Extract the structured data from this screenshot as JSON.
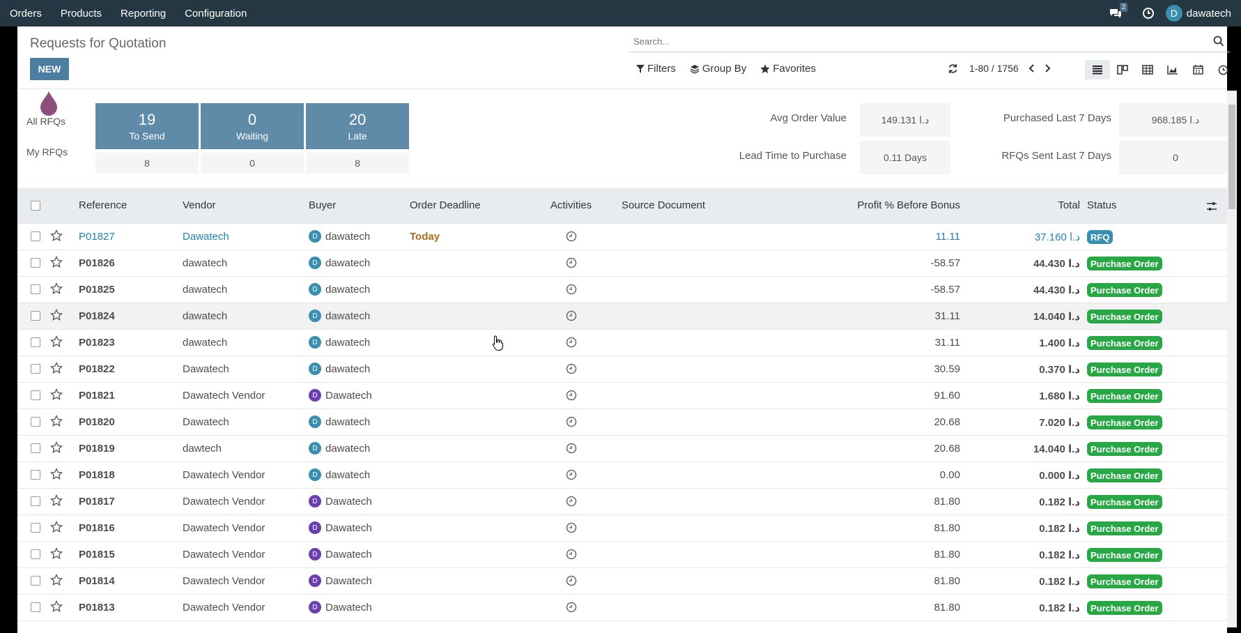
{
  "nav": {
    "menu": [
      "Orders",
      "Products",
      "Reporting",
      "Configuration"
    ],
    "messages_count": "2",
    "user": "dawatech",
    "user_initial": "D"
  },
  "control_panel": {
    "title": "Requests for Quotation",
    "new_label": "NEW",
    "search_placeholder": "Search...",
    "filters_label": "Filters",
    "groupby_label": "Group By",
    "favorites_label": "Favorites",
    "pager": "1-80 / 1756"
  },
  "dashboard": {
    "all_rfqs": "All RFQs",
    "my_rfqs": "My RFQs",
    "tiles": [
      {
        "count": "19",
        "label": "To Send",
        "mine": "8"
      },
      {
        "count": "0",
        "label": "Waiting",
        "mine": "0"
      },
      {
        "count": "20",
        "label": "Late",
        "mine": "8"
      }
    ],
    "kpis": {
      "avg_order_label": "Avg Order Value",
      "avg_order_value": "149.131 د.ا",
      "lead_time_label": "Lead Time to Purchase",
      "lead_time_value": "0.11 Days",
      "purchased_label": "Purchased Last 7 Days",
      "purchased_value": "968.185 د.ا",
      "rfqs_sent_label": "RFQs Sent Last 7 Days",
      "rfqs_sent_value": "0"
    }
  },
  "table": {
    "headers": {
      "reference": "Reference",
      "vendor": "Vendor",
      "buyer": "Buyer",
      "deadline": "Order Deadline",
      "activities": "Activities",
      "source": "Source Document",
      "profit": "Profit % Before Bonus",
      "total": "Total",
      "status": "Status"
    },
    "rows": [
      {
        "ref": "P01827",
        "vendor": "Dawatech",
        "buyer": "dawatech",
        "buyer_color": "#3a8fb0",
        "deadline": "Today",
        "profit": "11.11",
        "total": "37.160 د.ا",
        "status": "RFQ"
      },
      {
        "ref": "P01826",
        "vendor": "dawatech",
        "buyer": "dawatech",
        "buyer_color": "#3a8fb0",
        "deadline": "",
        "profit": "-58.57",
        "total": "44.430 د.ا",
        "status": "Purchase Order"
      },
      {
        "ref": "P01825",
        "vendor": "dawatech",
        "buyer": "dawatech",
        "buyer_color": "#3a8fb0",
        "deadline": "",
        "profit": "-58.57",
        "total": "44.430 د.ا",
        "status": "Purchase Order"
      },
      {
        "ref": "P01824",
        "vendor": "dawatech",
        "buyer": "dawatech",
        "buyer_color": "#3a8fb0",
        "deadline": "",
        "profit": "31.11",
        "total": "14.040 د.ا",
        "status": "Purchase Order"
      },
      {
        "ref": "P01823",
        "vendor": "dawatech",
        "buyer": "dawatech",
        "buyer_color": "#3a8fb0",
        "deadline": "",
        "profit": "31.11",
        "total": "1.400 د.ا",
        "status": "Purchase Order"
      },
      {
        "ref": "P01822",
        "vendor": "Dawatech",
        "buyer": "dawatech",
        "buyer_color": "#3a8fb0",
        "deadline": "",
        "profit": "30.59",
        "total": "0.370 د.ا",
        "status": "Purchase Order"
      },
      {
        "ref": "P01821",
        "vendor": "Dawatech Vendor",
        "buyer": "Dawatech",
        "buyer_color": "#6b3fb0",
        "deadline": "",
        "profit": "91.60",
        "total": "1.680 د.ا",
        "status": "Purchase Order"
      },
      {
        "ref": "P01820",
        "vendor": "Dawatech",
        "buyer": "dawatech",
        "buyer_color": "#3a8fb0",
        "deadline": "",
        "profit": "20.68",
        "total": "7.020 د.ا",
        "status": "Purchase Order"
      },
      {
        "ref": "P01819",
        "vendor": "dawtech",
        "buyer": "dawatech",
        "buyer_color": "#3a8fb0",
        "deadline": "",
        "profit": "20.68",
        "total": "14.040 د.ا",
        "status": "Purchase Order"
      },
      {
        "ref": "P01818",
        "vendor": "Dawatech Vendor",
        "buyer": "dawatech",
        "buyer_color": "#3a8fb0",
        "deadline": "",
        "profit": "0.00",
        "total": "0.000 د.ا",
        "status": "Purchase Order"
      },
      {
        "ref": "P01817",
        "vendor": "Dawatech Vendor",
        "buyer": "Dawatech",
        "buyer_color": "#6b3fb0",
        "deadline": "",
        "profit": "81.80",
        "total": "0.182 د.ا",
        "status": "Purchase Order"
      },
      {
        "ref": "P01816",
        "vendor": "Dawatech Vendor",
        "buyer": "Dawatech",
        "buyer_color": "#6b3fb0",
        "deadline": "",
        "profit": "81.80",
        "total": "0.182 د.ا",
        "status": "Purchase Order"
      },
      {
        "ref": "P01815",
        "vendor": "Dawatech Vendor",
        "buyer": "Dawatech",
        "buyer_color": "#6b3fb0",
        "deadline": "",
        "profit": "81.80",
        "total": "0.182 د.ا",
        "status": "Purchase Order"
      },
      {
        "ref": "P01814",
        "vendor": "Dawatech Vendor",
        "buyer": "Dawatech",
        "buyer_color": "#6b3fb0",
        "deadline": "",
        "profit": "81.80",
        "total": "0.182 د.ا",
        "status": "Purchase Order"
      },
      {
        "ref": "P01813",
        "vendor": "Dawatech Vendor",
        "buyer": "Dawatech",
        "buyer_color": "#6b3fb0",
        "deadline": "",
        "profit": "81.80",
        "total": "0.182 د.ا",
        "status": "Purchase Order"
      }
    ]
  },
  "colors": {
    "topbar": "#243742",
    "accent": "#4b7ea0",
    "tile": "#5f8aa8",
    "status_po": "#28a745",
    "status_rfq": "#3a8fb0",
    "link": "#1f7fb4"
  }
}
